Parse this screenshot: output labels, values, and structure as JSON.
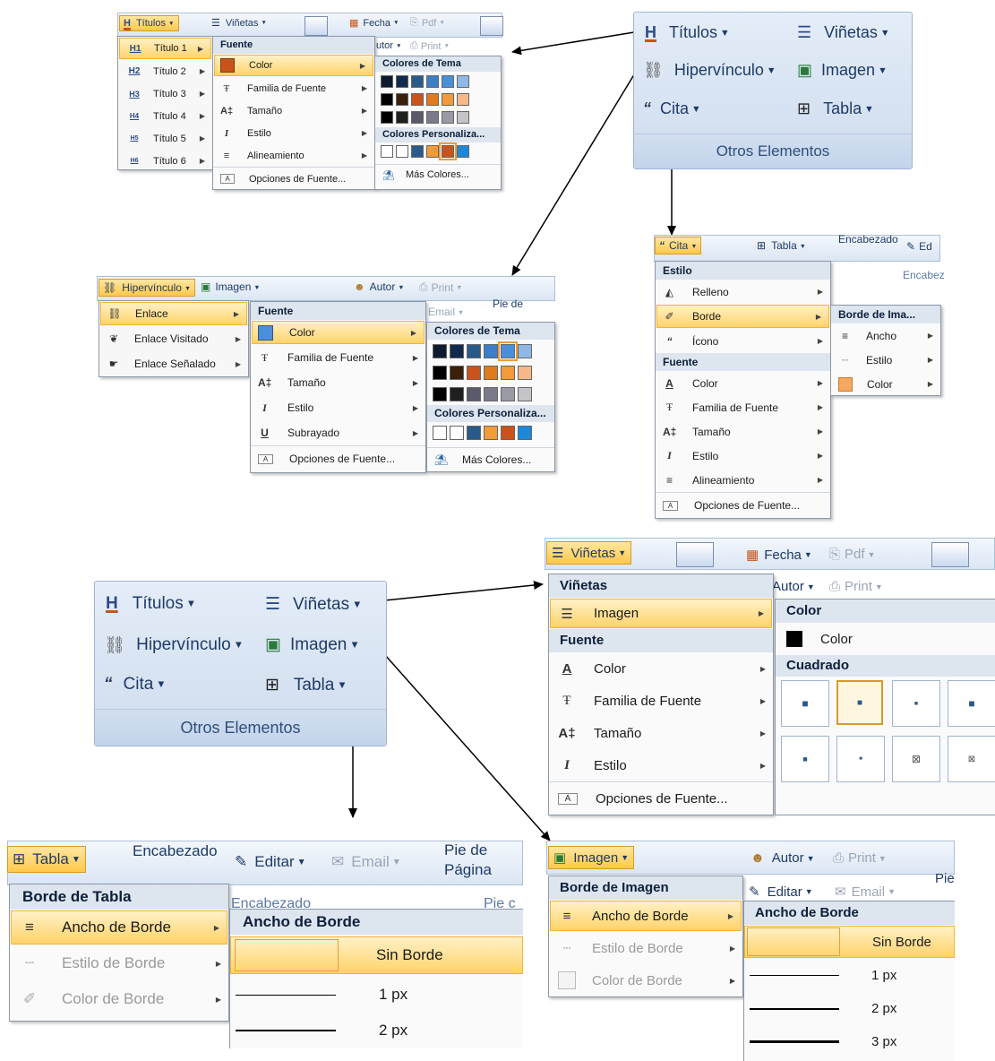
{
  "otros": {
    "titulos": "Títulos",
    "vinetas": "Viñetas",
    "hipervinculo": "Hipervínculo",
    "imagen": "Imagen",
    "cita": "Cita",
    "tabla": "Tabla",
    "group_label": "Otros Elementos"
  },
  "ribbon": {
    "fecha": "Fecha",
    "pdf": "Pdf",
    "autor": "Autor",
    "print": "Print",
    "email": "Email",
    "editar": "Editar",
    "encabezado": "Encabezado",
    "pie": "Pie de",
    "pagina": "Página",
    "ed": "Ed",
    "encabez": "Encabez",
    "utor": "utor",
    "pie_c": "Pie c",
    "pie_short": "Pie"
  },
  "titulos_menu": {
    "items": [
      "Título 1",
      "Título 2",
      "Título 3",
      "Título 4",
      "Título 5",
      "Título 6"
    ],
    "icons": [
      "H1",
      "H2",
      "H3",
      "H4",
      "H5",
      "H6"
    ]
  },
  "fuente_menu": {
    "header": "Fuente",
    "color": "Color",
    "familia": "Familia de Fuente",
    "tamano": "Tamaño",
    "estilo": "Estilo",
    "alineamiento": "Alineamiento",
    "subrayado": "Subrayado",
    "opciones": "Opciones de Fuente..."
  },
  "colores": {
    "tema": "Colores de Tema",
    "personaliza": "Colores Personaliza...",
    "mas": "Más Colores...",
    "palette_row1": [
      "#0b1a2e",
      "#0f2a4c",
      "#2a5a8a",
      "#3a7fc8",
      "#4a90d9",
      "#8fb8e6"
    ],
    "palette_row2": [
      "#000000",
      "#3a1f0a",
      "#c9541b",
      "#e07a1f",
      "#f39a3a",
      "#f5b88a"
    ],
    "palette_row3": [
      "#000000",
      "#1f1f1f",
      "#5a5a6a",
      "#7a7a8a",
      "#9a9aa6",
      "#c4c4c8"
    ],
    "custom_row": [
      "#ffffff",
      "#ffffff",
      "#2a5a8a",
      "#f39a3a",
      "#c9541b",
      "#1e88d8"
    ]
  },
  "hiper_menu": {
    "enlace": "Enlace",
    "visitado": "Enlace Visitado",
    "senalado": "Enlace Señalado"
  },
  "cita_menu": {
    "estilo": "Estilo",
    "relleno": "Relleno",
    "borde": "Borde",
    "icono": "Ícono",
    "borde_ima": "Borde de Ima...",
    "ancho": "Ancho",
    "estilo_sub": "Estilo",
    "color_sub": "Color"
  },
  "vinetas_menu": {
    "header": "Viñetas",
    "imagen": "Imagen",
    "color_header": "Color",
    "color": "Color",
    "cuadrado": "Cuadrado"
  },
  "tabla_menu": {
    "header": "Borde de Tabla",
    "ancho": "Ancho de Borde",
    "estilo": "Estilo de Borde",
    "color": "Color de Borde",
    "sub_header": "Ancho de Borde",
    "sin": "Sin Borde",
    "px1": "1 px",
    "px2": "2 px"
  },
  "imagen_menu": {
    "header": "Borde de Imagen",
    "ancho": "Ancho de Borde",
    "estilo": "Estilo de Borde",
    "color": "Color de Borde",
    "sub_header": "Ancho de Borde",
    "sin": "Sin Borde",
    "px1": "1 px",
    "px2": "2 px",
    "px3": "3 px"
  }
}
